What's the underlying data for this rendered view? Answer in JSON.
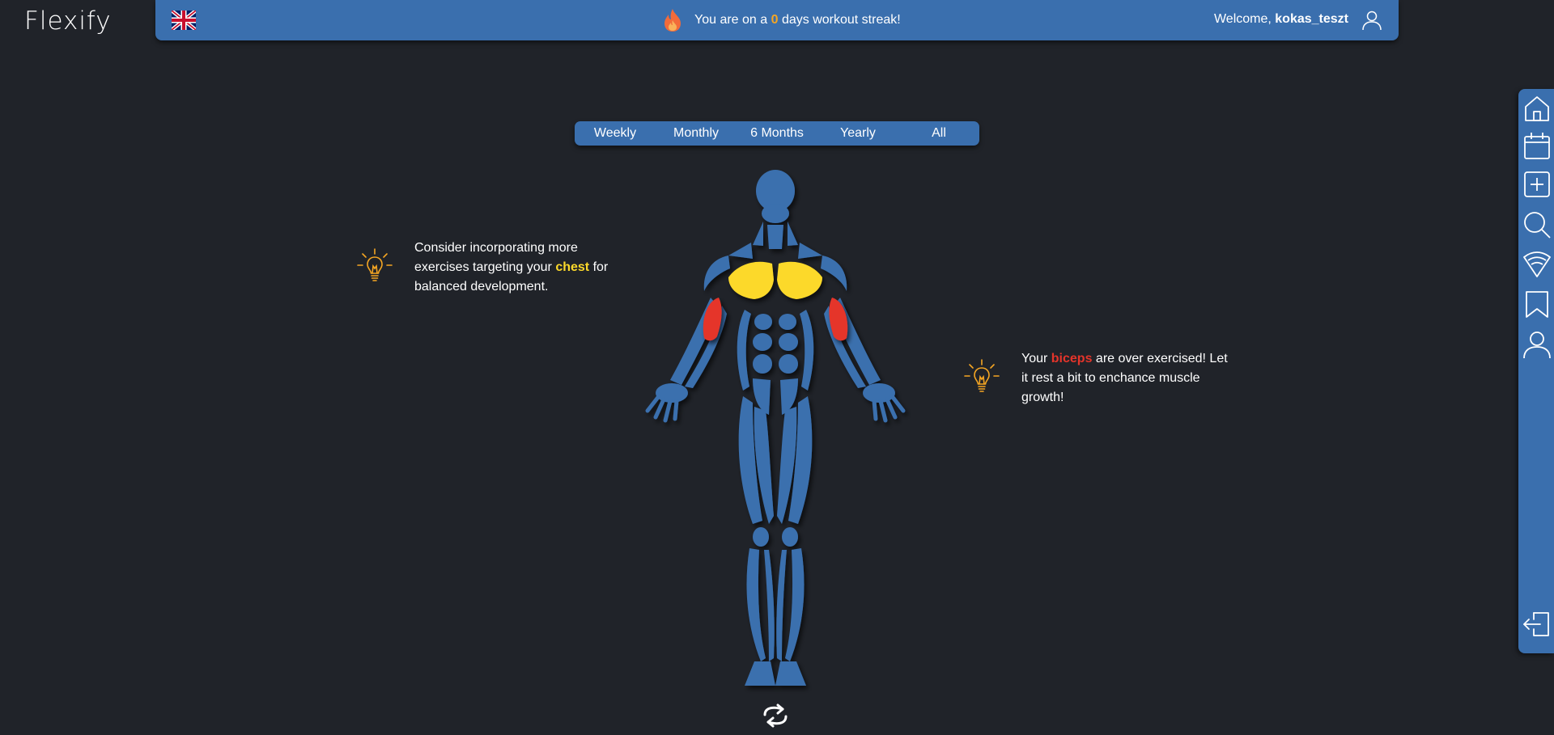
{
  "app": {
    "logo": "Flexify"
  },
  "header": {
    "streak_prefix": "You are on a",
    "streak_count": "0",
    "streak_suffix": "days workout streak!",
    "welcome_label": "Welcome,",
    "username": "kokas_teszt",
    "icons": [
      "uk-flag-icon",
      "flame-icon",
      "user-icon"
    ]
  },
  "period_tabs": [
    "Weekly",
    "Monthly",
    "6 Months",
    "Yearly",
    "All"
  ],
  "tips": [
    {
      "pre": "Consider incorporating more exercises targeting your",
      "muscle": "chest",
      "post": "for balanced development."
    },
    {
      "pre": "Your",
      "muscle": "biceps",
      "post": "are over exercised! Let it rest a bit to enchance muscle growth!"
    }
  ],
  "muscle_status": {
    "chest": "under-trained",
    "biceps": "over-trained"
  },
  "colors": {
    "accent": "#3a6fae",
    "background": "#202329",
    "under_trained": "#fcd92a",
    "over_trained": "#e5342a",
    "streak": "#f5a623"
  },
  "sidebar": {
    "icons": [
      "home-icon",
      "calendar-icon",
      "add-icon",
      "search-icon",
      "feed-icon",
      "bookmark-icon",
      "profile-icon",
      "logout-icon"
    ]
  }
}
